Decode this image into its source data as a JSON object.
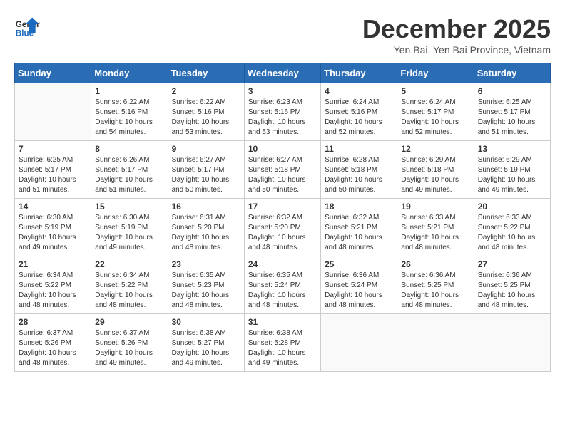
{
  "header": {
    "logo_line1": "General",
    "logo_line2": "Blue",
    "month_title": "December 2025",
    "subtitle": "Yen Bai, Yen Bai Province, Vietnam"
  },
  "weekdays": [
    "Sunday",
    "Monday",
    "Tuesday",
    "Wednesday",
    "Thursday",
    "Friday",
    "Saturday"
  ],
  "weeks": [
    [
      {
        "day": "",
        "info": ""
      },
      {
        "day": "1",
        "info": "Sunrise: 6:22 AM\nSunset: 5:16 PM\nDaylight: 10 hours\nand 54 minutes."
      },
      {
        "day": "2",
        "info": "Sunrise: 6:22 AM\nSunset: 5:16 PM\nDaylight: 10 hours\nand 53 minutes."
      },
      {
        "day": "3",
        "info": "Sunrise: 6:23 AM\nSunset: 5:16 PM\nDaylight: 10 hours\nand 53 minutes."
      },
      {
        "day": "4",
        "info": "Sunrise: 6:24 AM\nSunset: 5:16 PM\nDaylight: 10 hours\nand 52 minutes."
      },
      {
        "day": "5",
        "info": "Sunrise: 6:24 AM\nSunset: 5:17 PM\nDaylight: 10 hours\nand 52 minutes."
      },
      {
        "day": "6",
        "info": "Sunrise: 6:25 AM\nSunset: 5:17 PM\nDaylight: 10 hours\nand 51 minutes."
      }
    ],
    [
      {
        "day": "7",
        "info": "Sunrise: 6:25 AM\nSunset: 5:17 PM\nDaylight: 10 hours\nand 51 minutes."
      },
      {
        "day": "8",
        "info": "Sunrise: 6:26 AM\nSunset: 5:17 PM\nDaylight: 10 hours\nand 51 minutes."
      },
      {
        "day": "9",
        "info": "Sunrise: 6:27 AM\nSunset: 5:17 PM\nDaylight: 10 hours\nand 50 minutes."
      },
      {
        "day": "10",
        "info": "Sunrise: 6:27 AM\nSunset: 5:18 PM\nDaylight: 10 hours\nand 50 minutes."
      },
      {
        "day": "11",
        "info": "Sunrise: 6:28 AM\nSunset: 5:18 PM\nDaylight: 10 hours\nand 50 minutes."
      },
      {
        "day": "12",
        "info": "Sunrise: 6:29 AM\nSunset: 5:18 PM\nDaylight: 10 hours\nand 49 minutes."
      },
      {
        "day": "13",
        "info": "Sunrise: 6:29 AM\nSunset: 5:19 PM\nDaylight: 10 hours\nand 49 minutes."
      }
    ],
    [
      {
        "day": "14",
        "info": "Sunrise: 6:30 AM\nSunset: 5:19 PM\nDaylight: 10 hours\nand 49 minutes."
      },
      {
        "day": "15",
        "info": "Sunrise: 6:30 AM\nSunset: 5:19 PM\nDaylight: 10 hours\nand 49 minutes."
      },
      {
        "day": "16",
        "info": "Sunrise: 6:31 AM\nSunset: 5:20 PM\nDaylight: 10 hours\nand 48 minutes."
      },
      {
        "day": "17",
        "info": "Sunrise: 6:32 AM\nSunset: 5:20 PM\nDaylight: 10 hours\nand 48 minutes."
      },
      {
        "day": "18",
        "info": "Sunrise: 6:32 AM\nSunset: 5:21 PM\nDaylight: 10 hours\nand 48 minutes."
      },
      {
        "day": "19",
        "info": "Sunrise: 6:33 AM\nSunset: 5:21 PM\nDaylight: 10 hours\nand 48 minutes."
      },
      {
        "day": "20",
        "info": "Sunrise: 6:33 AM\nSunset: 5:22 PM\nDaylight: 10 hours\nand 48 minutes."
      }
    ],
    [
      {
        "day": "21",
        "info": "Sunrise: 6:34 AM\nSunset: 5:22 PM\nDaylight: 10 hours\nand 48 minutes."
      },
      {
        "day": "22",
        "info": "Sunrise: 6:34 AM\nSunset: 5:22 PM\nDaylight: 10 hours\nand 48 minutes."
      },
      {
        "day": "23",
        "info": "Sunrise: 6:35 AM\nSunset: 5:23 PM\nDaylight: 10 hours\nand 48 minutes."
      },
      {
        "day": "24",
        "info": "Sunrise: 6:35 AM\nSunset: 5:24 PM\nDaylight: 10 hours\nand 48 minutes."
      },
      {
        "day": "25",
        "info": "Sunrise: 6:36 AM\nSunset: 5:24 PM\nDaylight: 10 hours\nand 48 minutes."
      },
      {
        "day": "26",
        "info": "Sunrise: 6:36 AM\nSunset: 5:25 PM\nDaylight: 10 hours\nand 48 minutes."
      },
      {
        "day": "27",
        "info": "Sunrise: 6:36 AM\nSunset: 5:25 PM\nDaylight: 10 hours\nand 48 minutes."
      }
    ],
    [
      {
        "day": "28",
        "info": "Sunrise: 6:37 AM\nSunset: 5:26 PM\nDaylight: 10 hours\nand 48 minutes."
      },
      {
        "day": "29",
        "info": "Sunrise: 6:37 AM\nSunset: 5:26 PM\nDaylight: 10 hours\nand 49 minutes."
      },
      {
        "day": "30",
        "info": "Sunrise: 6:38 AM\nSunset: 5:27 PM\nDaylight: 10 hours\nand 49 minutes."
      },
      {
        "day": "31",
        "info": "Sunrise: 6:38 AM\nSunset: 5:28 PM\nDaylight: 10 hours\nand 49 minutes."
      },
      {
        "day": "",
        "info": ""
      },
      {
        "day": "",
        "info": ""
      },
      {
        "day": "",
        "info": ""
      }
    ]
  ]
}
